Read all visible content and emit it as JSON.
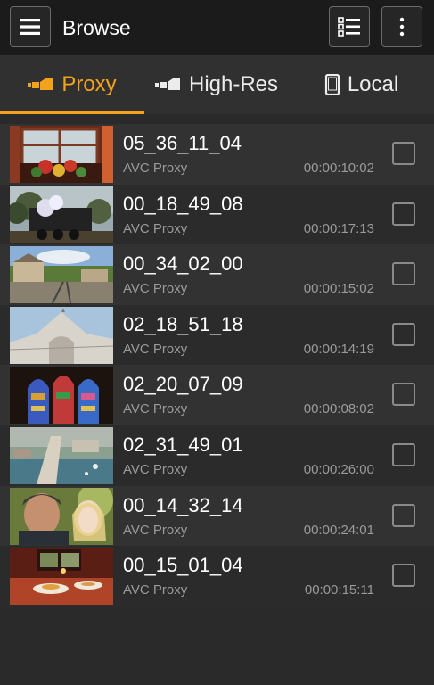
{
  "header": {
    "title": "Browse",
    "menu_icon": "hamburger-menu-icon",
    "view_icon": "list-view-icon",
    "more_icon": "more-vertical-icon"
  },
  "tabs": [
    {
      "label": "Proxy",
      "icon": "camera-proxy-icon",
      "active": true
    },
    {
      "label": "High-Res",
      "icon": "camera-highres-icon",
      "active": false
    },
    {
      "label": "Local",
      "icon": "phone-icon",
      "active": false
    }
  ],
  "colors": {
    "accent": "#f2a21b",
    "background": "#2a2a2a"
  },
  "clips": [
    {
      "name": "05_36_11_04",
      "type": "AVC Proxy",
      "duration": "00:00:10:02",
      "thumb": "window-flowers"
    },
    {
      "name": "00_18_49_08",
      "type": "AVC Proxy",
      "duration": "00:00:17:13",
      "thumb": "steam-train"
    },
    {
      "name": "00_34_02_00",
      "type": "AVC Proxy",
      "duration": "00:00:15:02",
      "thumb": "railway-station"
    },
    {
      "name": "02_18_51_18",
      "type": "AVC Proxy",
      "duration": "00:00:14:19",
      "thumb": "church-facade"
    },
    {
      "name": "02_20_07_09",
      "type": "AVC Proxy",
      "duration": "00:00:08:02",
      "thumb": "stained-glass"
    },
    {
      "name": "02_31_49_01",
      "type": "AVC Proxy",
      "duration": "00:00:26:00",
      "thumb": "aerial-harbor"
    },
    {
      "name": "00_14_32_14",
      "type": "AVC Proxy",
      "duration": "00:00:24:01",
      "thumb": "couple"
    },
    {
      "name": "00_15_01_04",
      "type": "AVC Proxy",
      "duration": "00:00:15:11",
      "thumb": "dinner-table"
    }
  ]
}
